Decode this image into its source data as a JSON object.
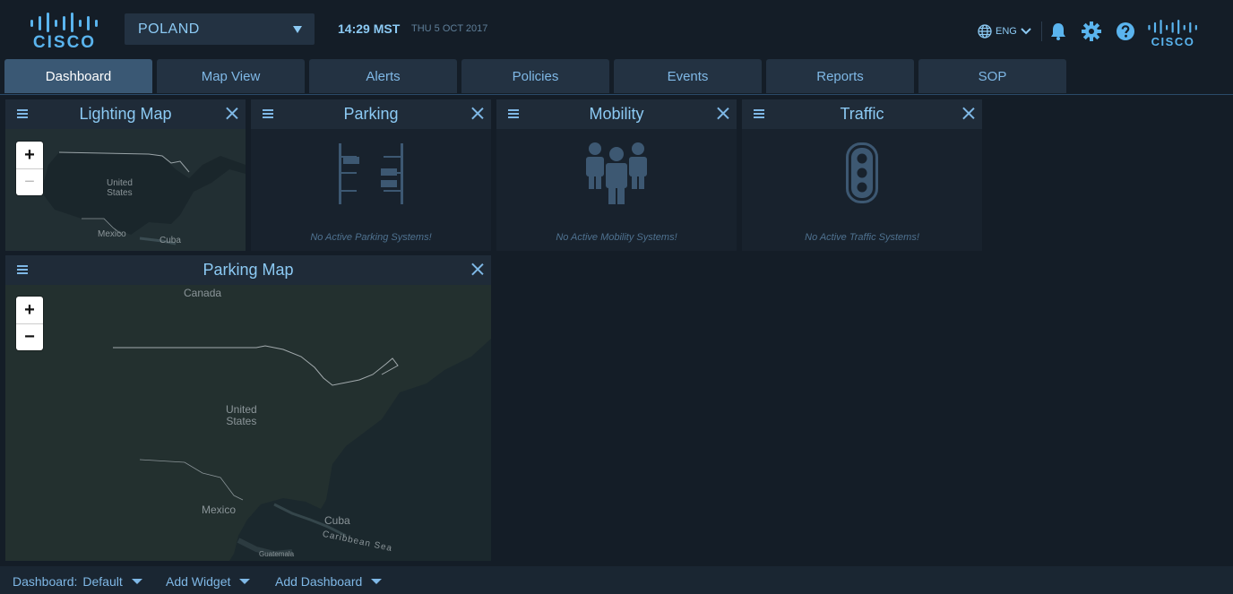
{
  "header": {
    "brand": "CISCO",
    "country": "POLAND",
    "time": "14:29 MST",
    "date": "THU 5 OCT 2017",
    "language": "ENG",
    "icons": [
      "globe-icon",
      "bell-icon",
      "gear-icon",
      "help-icon"
    ]
  },
  "tabs": [
    {
      "label": "Dashboard",
      "active": true
    },
    {
      "label": "Map View",
      "active": false
    },
    {
      "label": "Alerts",
      "active": false
    },
    {
      "label": "Policies",
      "active": false
    },
    {
      "label": "Events",
      "active": false
    },
    {
      "label": "Reports",
      "active": false
    },
    {
      "label": "SOP",
      "active": false
    }
  ],
  "widgets": {
    "lighting_map": {
      "title": "Lighting Map",
      "labels": {
        "us": "United\nStates",
        "mexico": "Mexico",
        "cuba": "Cuba"
      },
      "zoom_in": "+",
      "zoom_out": "−"
    },
    "parking": {
      "title": "Parking",
      "message": "No Active Parking Systems!"
    },
    "mobility": {
      "title": "Mobility",
      "message": "No Active Mobility Systems!"
    },
    "traffic": {
      "title": "Traffic",
      "message": "No Active Traffic Systems!"
    },
    "parking_map": {
      "title": "Parking Map",
      "labels": {
        "canada": "Canada",
        "us": "United\nStates",
        "mexico": "Mexico",
        "cuba": "Cuba",
        "caribbean": "Caribbean Sea",
        "guatemala": "Guatemala"
      },
      "zoom_in": "+",
      "zoom_out": "−"
    }
  },
  "footer": {
    "dashboard_label": "Dashboard:",
    "dashboard_value": "Default",
    "add_widget": "Add Widget",
    "add_dashboard": "Add Dashboard"
  },
  "colors": {
    "background": "#141d27",
    "accent": "#7fb8e6",
    "tab_active": "#3a5874",
    "tab": "#233242"
  }
}
